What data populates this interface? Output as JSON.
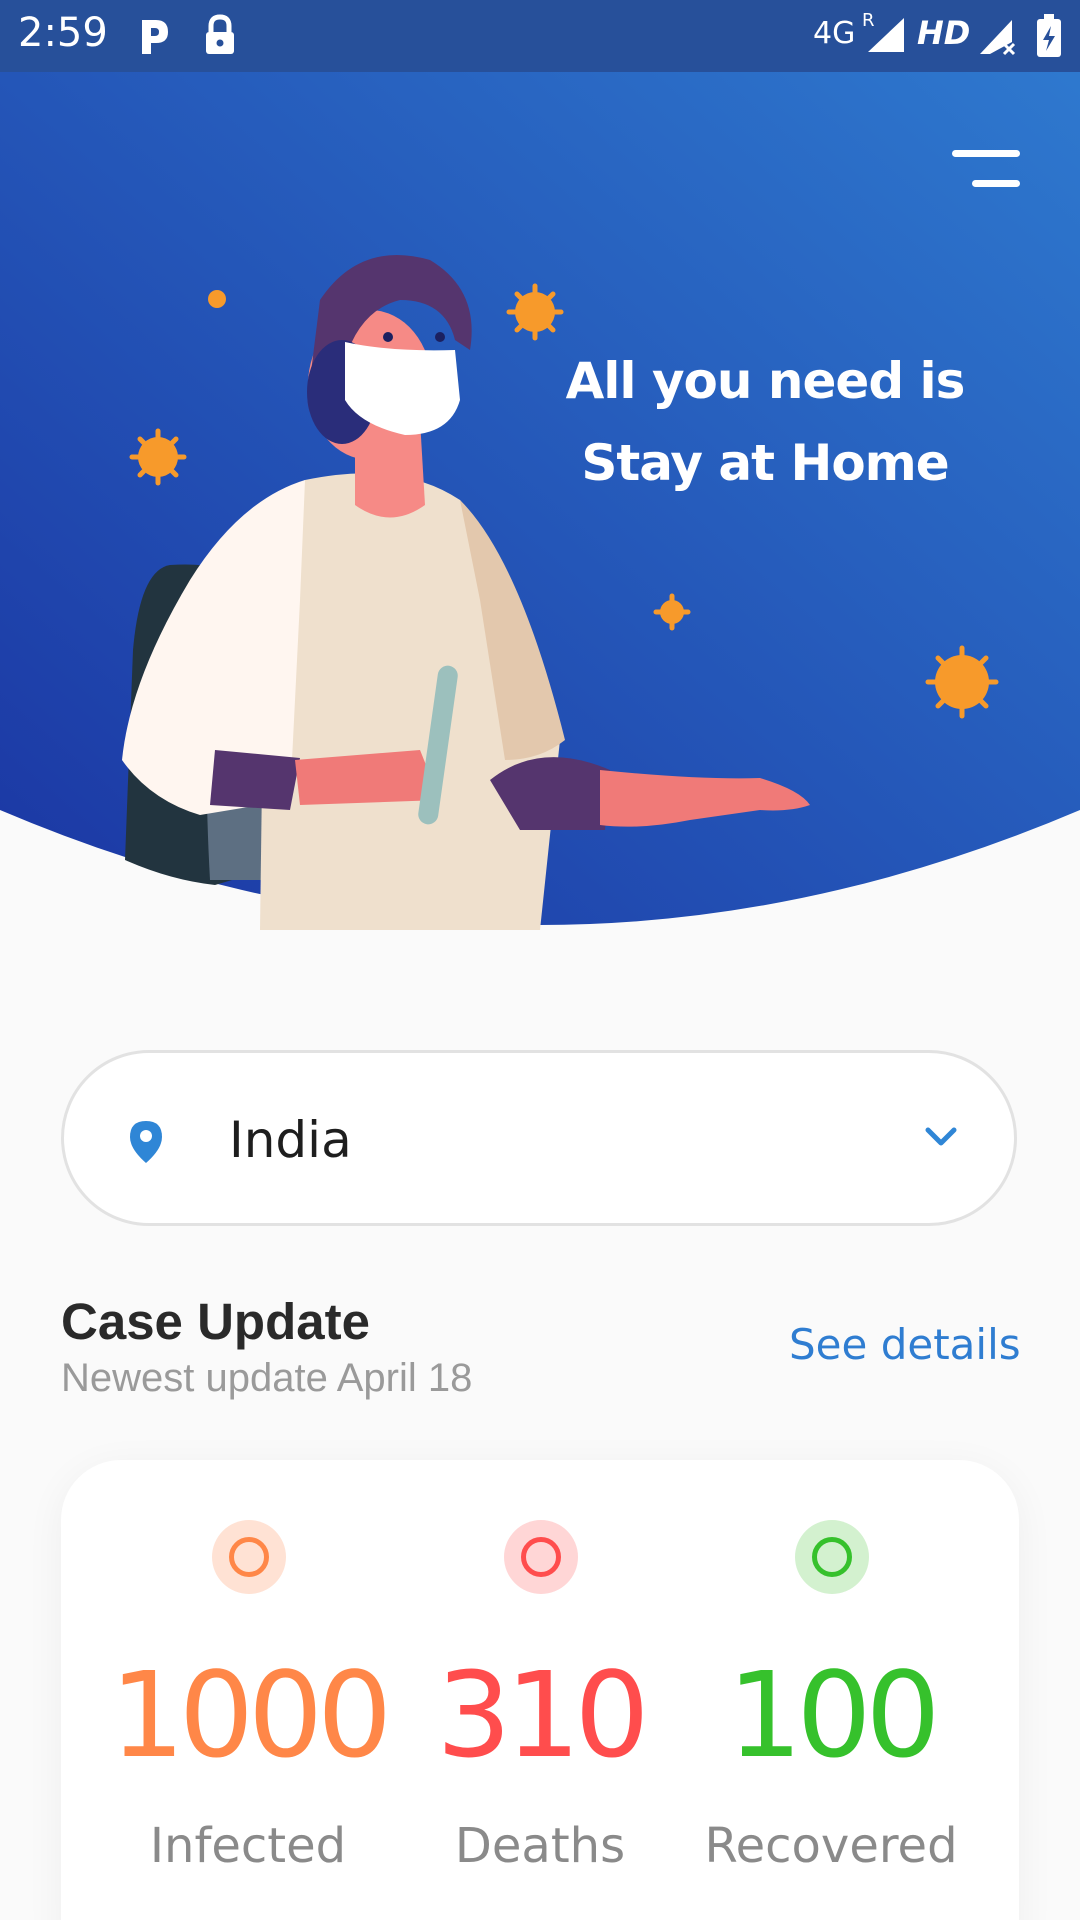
{
  "status_bar": {
    "time": "2:59",
    "network": "4G",
    "roaming": "R",
    "hd": "HD",
    "icons": [
      "parking-icon",
      "lock-icon",
      "signal-icon",
      "signal-no-service-icon",
      "battery-charging-icon"
    ]
  },
  "hero": {
    "headline_line1": "All you need is",
    "headline_line2": "Stay at Home",
    "menu_icon": "hamburger-menu-icon"
  },
  "location": {
    "icon": "location-pin-icon",
    "value": "India",
    "dropdown_icon": "chevron-down-icon"
  },
  "case_update": {
    "title": "Case Update",
    "subtitle": "Newest update April 18",
    "link_label": "See details"
  },
  "stats": [
    {
      "value": "1000",
      "label": "Infected",
      "color": "#ff8748",
      "bg": "#ffe2d4"
    },
    {
      "value": "310",
      "label": "Deaths",
      "color": "#ff4d4d",
      "bg": "#ffd6d6"
    },
    {
      "value": "100",
      "label": "Recovered",
      "color": "#36c12c",
      "bg": "#d3f1cf"
    }
  ],
  "colors": {
    "hero_gradient_top": "#2a74cc",
    "hero_gradient_bottom": "#1d3fa6",
    "accent": "#2f7dd1"
  }
}
